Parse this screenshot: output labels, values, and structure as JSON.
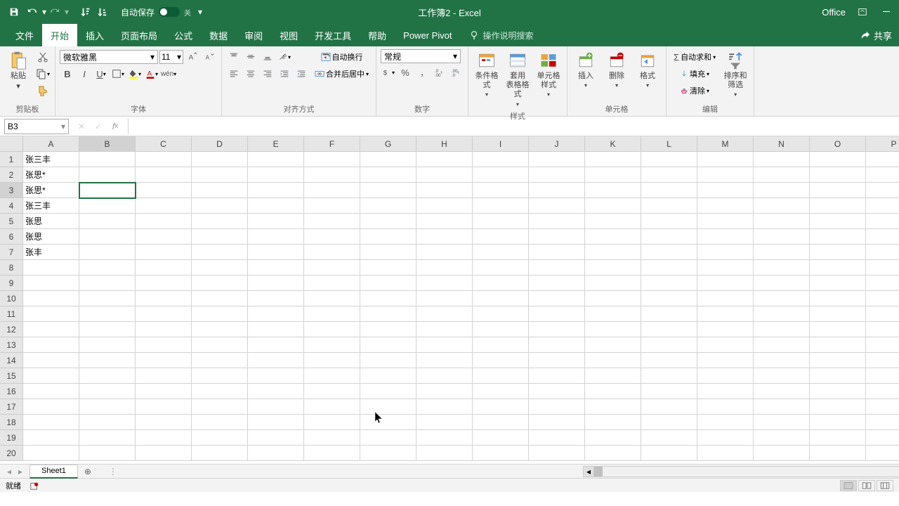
{
  "titlebar": {
    "autosave_label": "自动保存",
    "autosave_state": "关",
    "doc_title": "工作簿2  -  Excel",
    "office_label": "Office"
  },
  "tabs": {
    "file": "文件",
    "home": "开始",
    "insert": "插入",
    "layout": "页面布局",
    "formulas": "公式",
    "data": "数据",
    "review": "审阅",
    "view": "视图",
    "developer": "开发工具",
    "help": "帮助",
    "powerpivot": "Power Pivot",
    "tellme": "操作说明搜索",
    "share": "共享"
  },
  "ribbon": {
    "clipboard": {
      "label": "剪贴板",
      "paste": "粘贴"
    },
    "font": {
      "label": "字体",
      "name": "微软雅黑",
      "size": "11"
    },
    "alignment": {
      "label": "对齐方式",
      "wrap": "自动换行",
      "merge": "合并后居中"
    },
    "number": {
      "label": "数字",
      "format": "常规"
    },
    "styles": {
      "label": "样式",
      "cond": "条件格式",
      "table": "套用\n表格格式",
      "cell": "单元格样式"
    },
    "cells": {
      "label": "单元格",
      "insert": "插入",
      "delete": "删除",
      "format": "格式"
    },
    "editing": {
      "label": "编辑",
      "sum": "自动求和",
      "fill": "填充",
      "clear": "清除",
      "sort": "排序和筛选"
    }
  },
  "namebox": "B3",
  "columns": [
    "A",
    "B",
    "C",
    "D",
    "E",
    "F",
    "G",
    "H",
    "I",
    "J",
    "K",
    "L",
    "M",
    "N",
    "O",
    "P"
  ],
  "rows": 20,
  "active_cell": {
    "row": 3,
    "col": "B"
  },
  "cell_data": {
    "A1": "张三丰",
    "A2": "张思*",
    "A3": "张思*",
    "A4": "张三丰",
    "A5": "张思",
    "A6": "张思",
    "A7": "张丰"
  },
  "sheet": {
    "name": "Sheet1"
  },
  "status": {
    "ready": "就绪"
  }
}
